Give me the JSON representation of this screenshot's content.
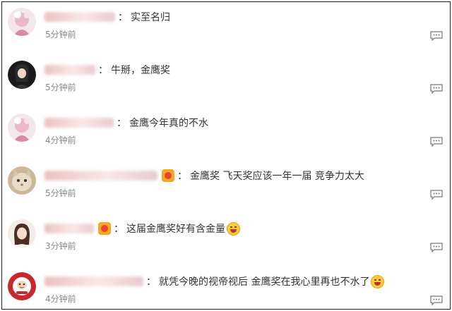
{
  "comments": [
    {
      "text": "实至名归",
      "time": "5分钟前",
      "badge": false,
      "emoji": false
    },
    {
      "text": "牛掰，金鹰奖",
      "time": "5分钟前",
      "badge": false,
      "emoji": false
    },
    {
      "text": "金鹰今年真的不水",
      "time": "4分钟前",
      "badge": false,
      "emoji": false
    },
    {
      "text": "金鹰奖 飞天奖应该一年一届 竞争力太大",
      "time": "5分钟前",
      "badge": true,
      "emoji": false
    },
    {
      "text": "这届金鹰奖好有含金量",
      "time": "3分钟前",
      "badge": true,
      "emoji": true
    },
    {
      "text": "就凭今晚的视帝视后 金鹰奖在我心里再也不水了",
      "time": "4分钟前",
      "badge": false,
      "emoji": true
    }
  ],
  "separator": "：",
  "icons": {
    "reply": "comment-reply-icon",
    "emoji": "laughing-emoji-icon",
    "badge": "member-badge-icon"
  },
  "colors": {
    "text": "#333333",
    "time": "#888888",
    "border": "#222222"
  }
}
